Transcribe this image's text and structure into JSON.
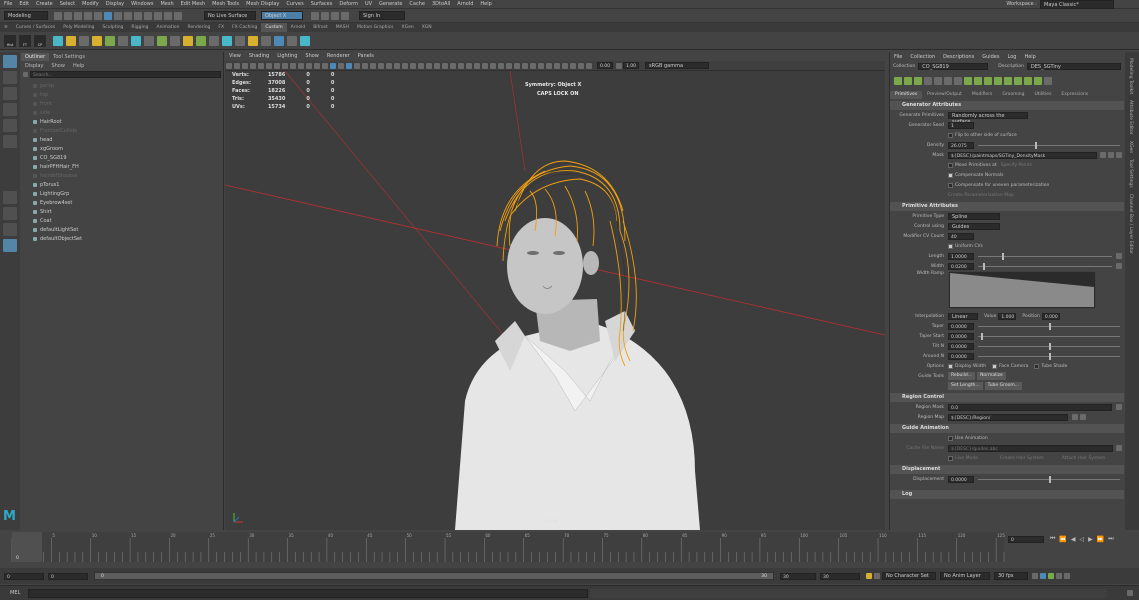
{
  "menubar": {
    "items": [
      "File",
      "Edit",
      "Create",
      "Select",
      "Modify",
      "Display",
      "Windows",
      "Mesh",
      "Edit Mesh",
      "Mesh Tools",
      "Mesh Display",
      "Curves",
      "Surfaces",
      "Deform",
      "UV",
      "Generate",
      "Cache",
      "3DtoAll",
      "Arnold",
      "Help"
    ],
    "workspace_label": "Workspace :",
    "workspace_value": "Maya Classic*"
  },
  "status": {
    "mode": "Modeling",
    "live_surface": "No Live Surface",
    "symmetry": "Object X",
    "sign_in": "Sign In"
  },
  "shelf": {
    "tabs": [
      "Curves / Surfaces",
      "Poly Modeling",
      "Sculpting",
      "Rigging",
      "Animation",
      "Rendering",
      "FX",
      "FX Caching",
      "Custom",
      "Arnold",
      "Bifrost",
      "MASH",
      "Motion Graphics",
      "XGen",
      "XGN"
    ],
    "active_index": 8,
    "first_icons": [
      "Hist",
      "FT",
      "CP"
    ]
  },
  "outliner": {
    "tabs": [
      "Outliner",
      "Tool Settings"
    ],
    "menus": [
      "Display",
      "Show",
      "Help"
    ],
    "search_placeholder": "Search...",
    "items": [
      {
        "label": "persp",
        "dim": true
      },
      {
        "label": "top",
        "dim": true
      },
      {
        "label": "front",
        "dim": true
      },
      {
        "label": "side",
        "dim": true
      },
      {
        "label": "HairRoot",
        "dim": false
      },
      {
        "label": "FrontsetCollide",
        "dim": true
      },
      {
        "label": "head",
        "dim": false
      },
      {
        "label": "xgGroom",
        "dim": false
      },
      {
        "label": "CO_SG819",
        "dim": false
      },
      {
        "label": "hairPFHHair_FH",
        "dim": false
      },
      {
        "label": "hairdefShadow",
        "dim": true
      },
      {
        "label": "pTorus1",
        "dim": false
      },
      {
        "label": "LightingGrp",
        "dim": false
      },
      {
        "label": "Eyebrow4set",
        "dim": false
      },
      {
        "label": "Shirt",
        "dim": false
      },
      {
        "label": "Coat",
        "dim": false
      },
      {
        "label": "defaultLightSet",
        "dim": false
      },
      {
        "label": "defaultObjectSet",
        "dim": false
      }
    ]
  },
  "viewport": {
    "menus": [
      "View",
      "Shading",
      "Lighting",
      "Show",
      "Renderer",
      "Panels"
    ],
    "exposure": "0.00",
    "gamma": "1.00",
    "colorspace": "sRGB gamma",
    "hud": [
      {
        "label": "Verts:",
        "v": "15786",
        "a": "0",
        "b": "0"
      },
      {
        "label": "Edges:",
        "v": "37008",
        "a": "0",
        "b": "0"
      },
      {
        "label": "Faces:",
        "v": "18226",
        "a": "0",
        "b": "0"
      },
      {
        "label": "Tris:",
        "v": "35430",
        "a": "0",
        "b": "0"
      },
      {
        "label": "UVs:",
        "v": "15734",
        "a": "0",
        "b": "0"
      }
    ],
    "symmetry": "Symmetry: Object X",
    "caps": "CAPS LOCK ON",
    "camera": "persp"
  },
  "xgen": {
    "menus": [
      "File",
      "Collection",
      "Descriptions",
      "Guides",
      "Log",
      "Help"
    ],
    "collection_label": "Collection",
    "collection": "CO_SG819",
    "description_label": "Description",
    "description": "DES_SGTiny",
    "tabs": [
      "Primitives",
      "Preview/Output",
      "Modifiers",
      "Grooming",
      "Utilities",
      "Expressions"
    ],
    "generator": {
      "title": "Generator Attributes",
      "prims_label": "Generate Primitives",
      "prims": "Randomly across the surface",
      "seed_label": "Generator Seed",
      "seed": "1",
      "flip": "Flip to other side of surface",
      "density_label": "Density",
      "density": "26.075",
      "mask_label": "Mask",
      "mask": "${DESC}/paintmaps/SGTiny_DensityMask",
      "move": "Move Primitives at",
      "move_val": "Specify Points",
      "comp_normals": "Compensate Normals",
      "comp_uneven": "Compensate for uneven parameterization",
      "create_param": "Create Parameterization Map"
    },
    "primitive": {
      "title": "Primitive Attributes",
      "type_label": "Primitive Type",
      "type": "Spline",
      "control_label": "Control using",
      "control": "Guides",
      "cv_label": "Modifier CV Count",
      "cv": "40",
      "uniform": "Uniform CVs",
      "length_label": "Length",
      "length": "1.0000",
      "width_label": "Width",
      "width": "0.0200",
      "ramp_label": "Width Ramp",
      "interp_label": "Interpolation",
      "interp": "Linear",
      "value_label": "Value",
      "value": "1.000",
      "pos_label": "Position",
      "pos": "0.000",
      "taper_label": "Taper",
      "taper": "0.0000",
      "tstart_label": "Taper Start",
      "tstart": "0.0000",
      "tiltn_label": "Tilt N",
      "tiltn": "0.0000",
      "around_label": "Around N",
      "around": "0.0000",
      "options_label": "Options",
      "o1": "Display Width",
      "o2": "Face Camera",
      "o3": "Tube Shade",
      "guide_label": "Guide Tools",
      "g1": "Rebuild...",
      "g2": "Normalize",
      "g3": "Set Length...",
      "g4": "Tube Groom..."
    },
    "region": {
      "title": "Region Control",
      "mask_label": "Region Mask",
      "mask": "0.0",
      "map_label": "Region Map",
      "map": "${DESC}/Region/"
    },
    "anim": {
      "title": "Guide Animation",
      "use": "Use Animation",
      "cache_label": "Cache File Name",
      "cache": "${DESC}/guides.abc",
      "live": "Live Mode",
      "create": "Create Hair System",
      "attach": "Attach Hair System"
    },
    "disp": {
      "title": "Displacement",
      "label": "Displacement",
      "value": "0.0000"
    },
    "log": "Log",
    "side_tabs": [
      "Modeling Toolkit",
      "Attribute Editor",
      "XGen",
      "Tool Settings",
      "Channel Box / Layer Editor"
    ]
  },
  "timeline": {
    "ticks": [
      "0",
      "5",
      "10",
      "15",
      "20",
      "25",
      "30",
      "35",
      "40",
      "45",
      "50",
      "55",
      "60",
      "65",
      "70",
      "75",
      "80",
      "85",
      "90",
      "95",
      "100",
      "105",
      "110",
      "115",
      "120",
      "125"
    ],
    "current": "0"
  },
  "range": {
    "start": "0",
    "inner_start": "0",
    "value": "0",
    "end": "30",
    "end2": "30",
    "inner_end": "30",
    "character": "No Character Set",
    "anim_layer": "No Anim Layer",
    "fps": "30 fps"
  },
  "cmd": {
    "label": "MEL"
  },
  "colors": {
    "hair": "#f0a010",
    "axis": "#c83232",
    "bg": "#444444"
  }
}
